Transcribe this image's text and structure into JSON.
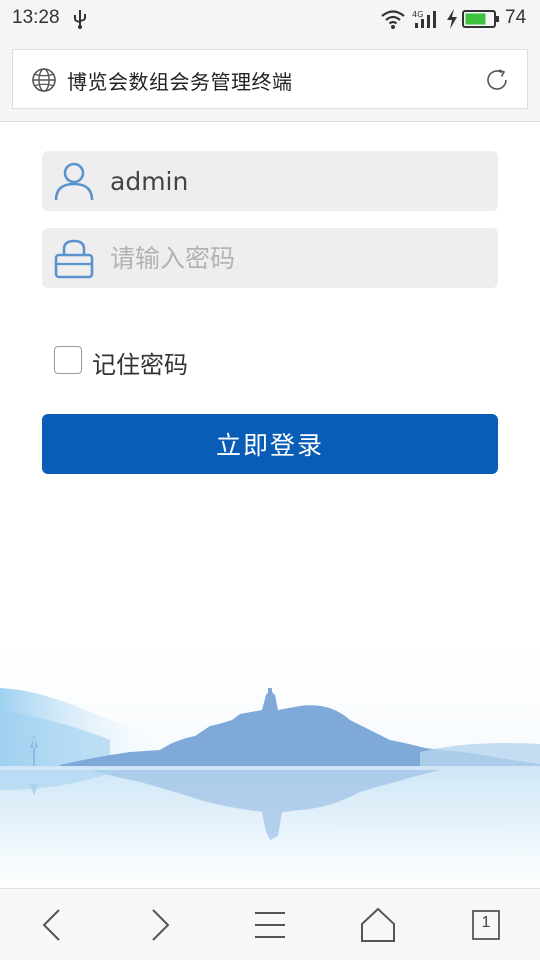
{
  "status_bar": {
    "time": "13:28",
    "battery_level": "74",
    "battery_fraction": 0.74,
    "icons": [
      "usb-icon",
      "wifi-icon",
      "signal-4g-icon",
      "charging-bolt-icon",
      "battery-icon"
    ]
  },
  "browser": {
    "address_title": "博览会数组会务管理终端",
    "icons": [
      "globe-icon",
      "reload-icon"
    ]
  },
  "login_form": {
    "username_value": "admin",
    "password_placeholder": "请输入密码",
    "remember_label": "记住密码",
    "remember_checked": false,
    "submit_label": "立即登录",
    "accent_color": "#0a5db6"
  },
  "bottom_nav": {
    "tab_count": "1",
    "icons": [
      "back-icon",
      "forward-icon",
      "menu-icon",
      "home-icon",
      "tabs-icon"
    ]
  }
}
